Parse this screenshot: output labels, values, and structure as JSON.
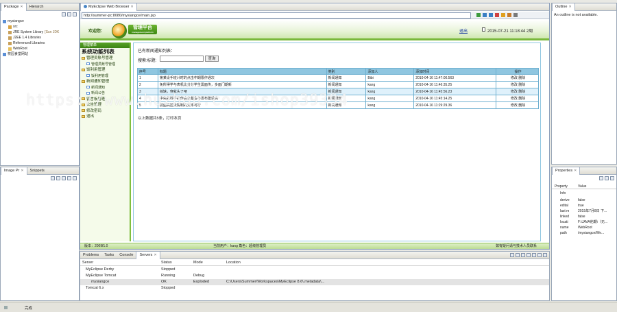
{
  "package_panel": {
    "tabs": [
      "Package",
      "Hierarch"
    ],
    "tree": [
      {
        "label": "mysiangce",
        "indent": 0,
        "icon": "project-icon"
      },
      {
        "label": "src",
        "indent": 1,
        "icon": "src-folder-icon"
      },
      {
        "label": "JRE System Library",
        "suffix": "[Sun JDK",
        "indent": 1,
        "icon": "library-icon"
      },
      {
        "label": "J2EE 1.4 Libraries",
        "indent": 1,
        "icon": "library-icon"
      },
      {
        "label": "Referenced Libraries",
        "indent": 1,
        "icon": "library-icon"
      },
      {
        "label": "WebRoot",
        "indent": 1,
        "icon": "folder-icon"
      },
      {
        "label": "校园食堂网站",
        "indent": 0,
        "icon": "project-icon"
      }
    ]
  },
  "image_panel": {
    "tabs": [
      "Image Pr",
      "Snippets"
    ]
  },
  "browser": {
    "tab_label": "MyEclipse Web Browser",
    "url": "http://summer-pc:8080/mysiangce/main.jsp",
    "site": {
      "welcome": "欢迎您：",
      "logo_text": "管理平台",
      "logo_sub": "management platform",
      "logout": "退出",
      "datetime": "2015-07-21 11:18:44 2周",
      "menu_head": "管理菜单",
      "menu": [
        {
          "label": "系统功能列表",
          "level": "title"
        },
        {
          "label": "管理员账号管理",
          "level": "top"
        },
        {
          "label": "管理员账号管理",
          "level": "sub"
        },
        {
          "label": "饭利用管理",
          "level": "top"
        },
        {
          "label": "饭利用管理",
          "level": "sub"
        },
        {
          "label": "新闻通知管理",
          "level": "top"
        },
        {
          "label": "新闻通知",
          "level": "sub"
        },
        {
          "label": "新闻公告",
          "level": "sub"
        },
        {
          "label": "留言板管理",
          "level": "top"
        },
        {
          "label": "公告管理",
          "level": "top"
        },
        {
          "label": "修改密码",
          "level": "top"
        },
        {
          "label": "退出",
          "level": "top"
        }
      ],
      "content": {
        "heading": "已有新闻通知列表：",
        "search_label": "搜索:标题:",
        "search_value": "",
        "search_button": "查询",
        "table": {
          "headers": [
            "序号",
            "标题",
            "类别",
            "添加人",
            "添加时间",
            "操作"
          ],
          "rows": [
            [
              "1",
              "第某设手班计时的点击中期限作通次",
              "新闻通知",
              "Bibi",
              "2010-04-16 11:47:00.563",
              "修改 删除"
            ],
            [
              "2",
              "免所得学与表机比分分学生需面传，多面门期新",
              "新闻通知",
              "kang",
              "2010-04-16 11:46:35.25",
              "修改 删除"
            ],
            [
              "3",
              "综缺，穿就头了吧",
              "新闻通知",
              "kang",
              "2010-04-16 11:45:56.23",
              "修改 删除"
            ],
            [
              "4",
              "中央的科学的作会合基金与发布建设高",
              "新闻通知",
              "kang",
              "2010-04-16 11:45:14.25",
              "修改 删除"
            ],
            [
              "5",
              "前面高区法院制的交本可行",
              "新闻通知",
              "kang",
              "2010-04-16 11:29:29.36",
              "修改 删除"
            ]
          ],
          "selected_row": 2
        },
        "footer": "以上数据共5条，打印本页"
      },
      "status_left": "版本：2009f1.0",
      "status_mid": "当前用户：kang  角色：超级管理员",
      "status_right": "如有疑问请与技术人员联系"
    }
  },
  "outline": {
    "tab": "Outline",
    "message": "An outline is not available."
  },
  "properties": {
    "tab": "Properties",
    "headers": [
      "Property",
      "Value"
    ],
    "group": "Info",
    "rows": [
      [
        "derive",
        "false"
      ],
      [
        "edital",
        "true"
      ],
      [
        "last m",
        "2015年7月8日 下..."
      ],
      [
        "linked",
        "false"
      ],
      [
        "locati",
        "F:\\JAVA他期\\（无..."
      ],
      [
        "name",
        "WebRoot"
      ],
      [
        "path",
        "/mysiangce/We..."
      ]
    ]
  },
  "bottom": {
    "tabs": [
      "Problems",
      "Tasks",
      "Console",
      "Servers"
    ],
    "headers": [
      "Server",
      "Status",
      "Mode",
      "Location"
    ],
    "rows": [
      {
        "server": "MyEclipse Derby",
        "status": "Stopped",
        "mode": "",
        "location": "",
        "indent": 1
      },
      {
        "server": "MyEclipse Tomcat",
        "status": "Running",
        "mode": "Debug",
        "location": "",
        "indent": 1
      },
      {
        "server": "mysiangce",
        "status": "OK",
        "mode": "Exploded",
        "location": "C:\\Users\\Summer\\Workspaces\\MyEclipse 8.6\\.metadata\\...",
        "indent": 2
      },
      {
        "server": "Tomcat  6.x",
        "status": "Stopped",
        "mode": "",
        "location": "",
        "indent": 1
      }
    ]
  },
  "statusbar": {
    "text": "完成"
  },
  "watermark": "https://www.huzhan.com/ishop39394"
}
